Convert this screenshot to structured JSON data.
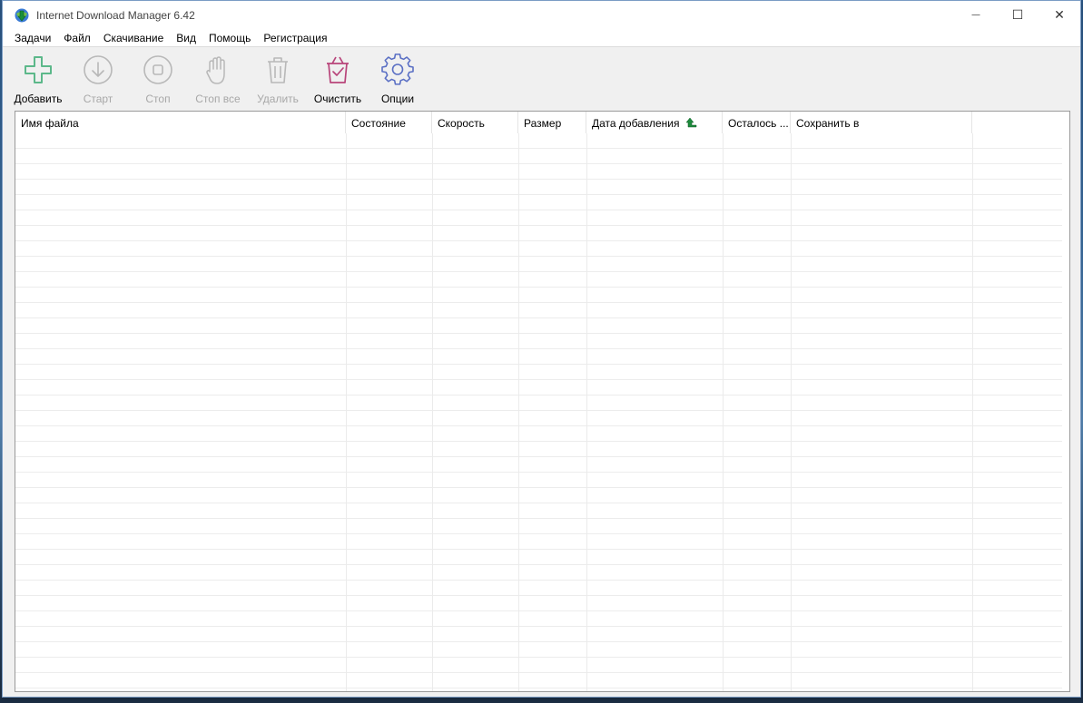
{
  "window": {
    "title": "Internet Download Manager 6.42",
    "controls": {
      "minimize": "—",
      "maximize": "☐",
      "close": "✕"
    }
  },
  "menu": [
    "Задачи",
    "Файл",
    "Скачивание",
    "Вид",
    "Помощь",
    "Регистрация"
  ],
  "toolbar": [
    {
      "label": "Добавить",
      "icon": "add-icon",
      "enabled": true
    },
    {
      "label": "Старт",
      "icon": "start-download-icon",
      "enabled": false
    },
    {
      "label": "Стоп",
      "icon": "stop-icon",
      "enabled": false
    },
    {
      "label": "Стоп все",
      "icon": "stop-all-hand-icon",
      "enabled": false
    },
    {
      "label": "Удалить",
      "icon": "trash-icon",
      "enabled": false
    },
    {
      "label": "Очистить",
      "icon": "clear-basket-icon",
      "enabled": true
    },
    {
      "label": "Опции",
      "icon": "gear-icon",
      "enabled": true
    }
  ],
  "columns": [
    "Имя файла",
    "Состояние",
    "Скорость",
    "Размер",
    "Дата добавления",
    "Осталось ...",
    "Сохранить в"
  ],
  "sort": {
    "column": "Дата добавления",
    "direction": "ascending",
    "icon": "sort-up-arrow-icon"
  },
  "colors": {
    "add": "#5cb88a",
    "clear": "#b8447a",
    "options": "#5a6fc4",
    "disabled": "#b8b8b8"
  }
}
